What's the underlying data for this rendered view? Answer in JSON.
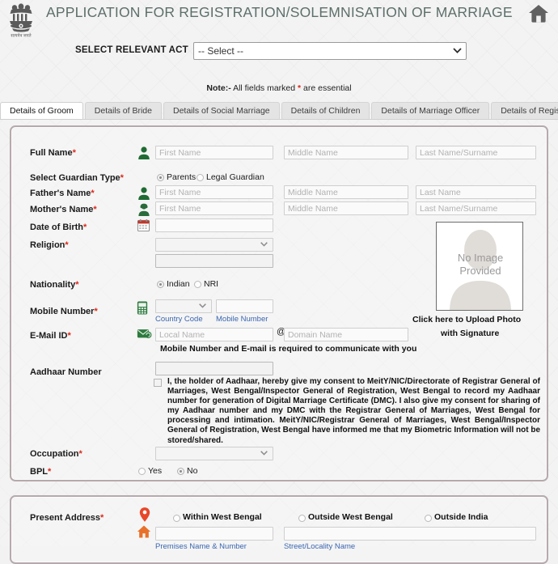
{
  "header": {
    "title": "APPLICATION FOR REGISTRATION/SOLEMNISATION OF MARRIAGE",
    "emblem_icon": "india-national-emblem",
    "emblem_motto": "सत्यमेव जयते",
    "home_icon": "home-icon",
    "title_color": "#5d6f6b"
  },
  "act": {
    "label": "SELECT RELEVANT ACT",
    "selected": "-- Select --",
    "options": [
      "-- Select --"
    ],
    "caret_icon": "chevron-down-icon"
  },
  "note": {
    "bold": "Note:-",
    "text_before": " All fields marked ",
    "asterisk": "*",
    "text_after": " are essential",
    "asterisk_color": "#d9291c"
  },
  "tabs": [
    {
      "label": "Details of Groom",
      "active": true
    },
    {
      "label": "Details of Bride",
      "active": false
    },
    {
      "label": "Details of Social Marriage",
      "active": false
    },
    {
      "label": "Details of Children",
      "active": false
    },
    {
      "label": "Details of Marriage Officer",
      "active": false
    },
    {
      "label": "Details of Registration",
      "active": false
    }
  ],
  "groom": {
    "full_name": {
      "label": "Full Name",
      "required": "*",
      "icon": "person-icon",
      "first_placeholder": "First Name",
      "middle_placeholder": "Middle Name",
      "last_placeholder": "Last Name/Surname",
      "first_value": "",
      "middle_value": "",
      "last_value": ""
    },
    "guardian_type": {
      "label": "Select Guardian Type",
      "required": "*",
      "options": [
        {
          "label": "Parents",
          "selected": true
        },
        {
          "label": "Legal Guardian",
          "selected": false
        }
      ]
    },
    "father_name": {
      "label": "Father's Name",
      "required": "*",
      "icon": "person-icon",
      "first_placeholder": "First Name",
      "middle_placeholder": "Middle Name",
      "last_placeholder": "Last Name",
      "first_value": "",
      "middle_value": "",
      "last_value": ""
    },
    "mother_name": {
      "label": "Mother's Name",
      "required": "*",
      "icon": "person-female-icon",
      "first_placeholder": "First Name",
      "middle_placeholder": "Middle Name",
      "last_placeholder": "Last Name/Surname",
      "first_value": "",
      "middle_value": "",
      "last_value": ""
    },
    "dob": {
      "label": "Date of Birth",
      "required": "*",
      "icon": "calendar-icon",
      "value": "",
      "placeholder": ""
    },
    "religion": {
      "label": "Religion",
      "required": "*",
      "selected": "",
      "options": [
        ""
      ],
      "other_value": "",
      "other_placeholder": "",
      "caret_icon": "chevron-down-icon"
    },
    "nationality": {
      "label": "Nationality",
      "required": "*",
      "options": [
        {
          "label": "Indian",
          "selected": true
        },
        {
          "label": "NRI",
          "selected": false
        }
      ]
    },
    "mobile": {
      "label": "Mobile Number",
      "required": "*",
      "icon": "mobile-phone-icon",
      "country_code_value": "",
      "country_code_sub_label": "Country Code",
      "number_value": "",
      "number_sub_label": "Mobile Number",
      "caret_icon": "chevron-down-icon"
    },
    "email": {
      "label": "E-Mail ID",
      "required": "*",
      "icon": "email-icon",
      "local_placeholder": "Local Name",
      "at_symbol": "@",
      "domain_placeholder": "Domain Name",
      "local_value": "",
      "domain_value": ""
    },
    "communicate_hint": "Mobile Number and E-mail is required to communicate with you",
    "aadhaar": {
      "label": "Aadhaar Number",
      "required": "",
      "value": "",
      "placeholder": ""
    },
    "consent": {
      "checked": false,
      "text": "I, the holder of Aadhaar, hereby give my consent to MeitY/NIC/Directorate of Registrar General of Marriages, West Bengal/Inspector General of Registration, West Bengal to record my Aadhaar number for generation of Digital Marriage Certificate (DMC). I also give my consent for sharing of my Aadhaar number and my DMC with the Registrar General of Marriages, West Bengal for processing and intimation. MeitY/NIC/Registrar General of Marriages, West Bengal/Inspector General of Registration, West Bengal have informed me that my Biometric Information will not be stored/shared."
    },
    "occupation": {
      "label": "Occupation",
      "required": "*",
      "selected": "",
      "options": [
        ""
      ],
      "caret_icon": "chevron-down-icon"
    },
    "bpl": {
      "label": "BPL",
      "required": "*",
      "options": [
        {
          "label": "Yes",
          "selected": false
        },
        {
          "label": "No",
          "selected": true
        }
      ]
    },
    "photo": {
      "placeholder_line1": "No Image",
      "placeholder_line2": "Provided",
      "upload_line1": "Click here to Upload Photo",
      "upload_line2": "with Signature",
      "silhouette_icon": "person-silhouette-icon"
    }
  },
  "address": {
    "label": "Present Address",
    "required": "*",
    "pin_icon": "map-pin-icon",
    "house_icon": "house-icon",
    "options": [
      {
        "label": "Within West Bengal",
        "selected": false
      },
      {
        "label": "Outside West Bengal",
        "selected": false
      },
      {
        "label": "Outside India",
        "selected": false
      }
    ],
    "premises_value": "",
    "premises_sub_label": "Premises Name & Number",
    "street_value": "",
    "street_sub_label": "Street/Locality Name"
  }
}
